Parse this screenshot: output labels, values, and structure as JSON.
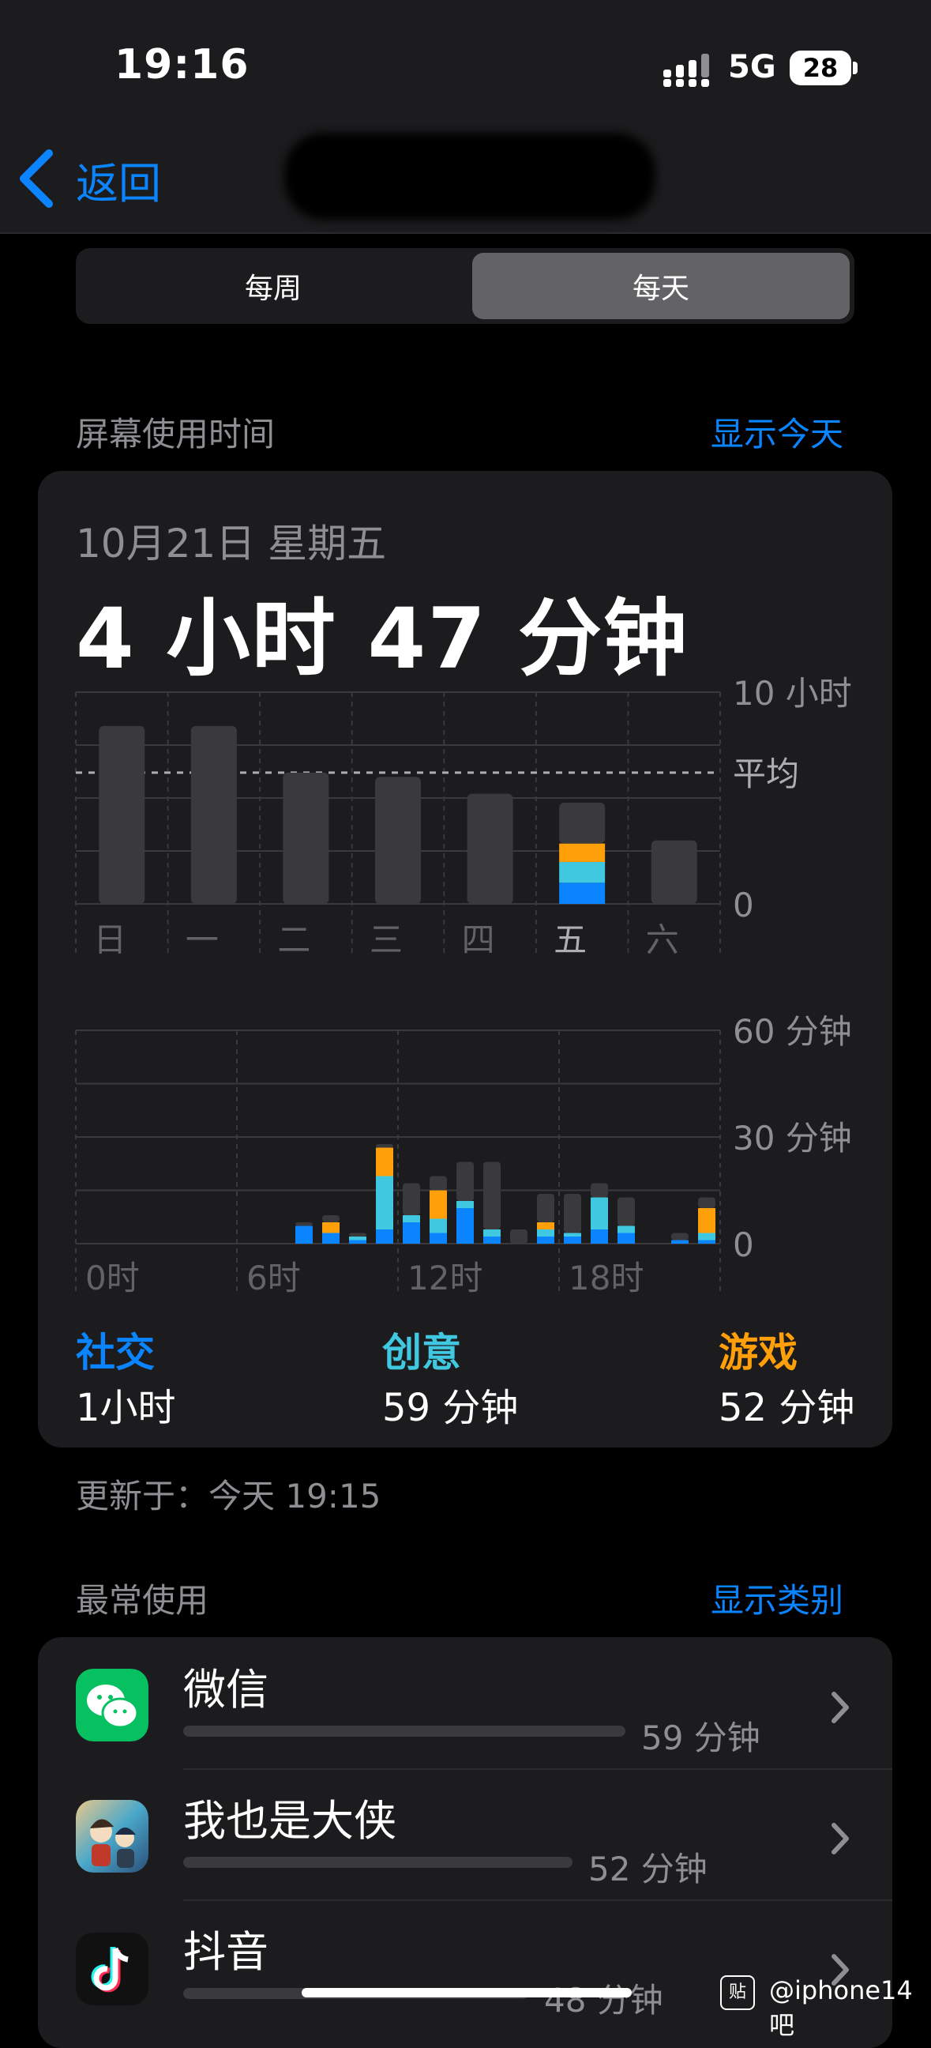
{
  "status_bar": {
    "time": "19:16",
    "network": "5G",
    "battery": "28"
  },
  "nav": {
    "back_label": "返回"
  },
  "segmented": {
    "options": [
      "每周",
      "每天"
    ],
    "selected": "每天"
  },
  "screen_time": {
    "section_title": "屏幕使用时间",
    "show_today": "显示今天",
    "date": "10月21日 星期五",
    "total": "4 小时 47 分钟",
    "categories": [
      {
        "name": "社交",
        "value": "1小时",
        "color": "#0a84ff"
      },
      {
        "name": "创意",
        "value": "59 分钟",
        "color": "#40c8e0"
      },
      {
        "name": "游戏",
        "value": "52 分钟",
        "color": "#ff9f0a"
      }
    ],
    "updated": "更新于：今天 19:15"
  },
  "chart_data": [
    {
      "type": "bar",
      "categories": [
        "日",
        "一",
        "二",
        "三",
        "四",
        "五",
        "六"
      ],
      "ylabels": [
        "10 小时",
        "平均",
        "0"
      ],
      "ylim": [
        0,
        10
      ],
      "average": 6.2,
      "values": [
        8.4,
        8.4,
        6.2,
        6.0,
        5.2,
        4.78,
        3.0
      ],
      "selected_category": "五",
      "selected_breakdown": {
        "social": 1.0,
        "creative": 0.98,
        "games": 0.87,
        "other": 1.93
      },
      "colors": {
        "other": "#3a3a3c",
        "social": "#0a84ff",
        "creative": "#40c8e0",
        "games": "#ff9f0a"
      }
    },
    {
      "type": "bar",
      "stacked": true,
      "x_ticks": [
        "0时",
        "6时",
        "12时",
        "18时"
      ],
      "ylabels": [
        "60 分钟",
        "30 分钟",
        "0"
      ],
      "ylim": [
        0,
        60
      ],
      "hours": [
        0,
        1,
        2,
        3,
        4,
        5,
        6,
        7,
        8,
        9,
        10,
        11,
        12,
        13,
        14,
        15,
        16,
        17,
        18,
        19,
        20,
        21,
        22,
        23
      ],
      "series": [
        {
          "name": "社交",
          "values": [
            0,
            0,
            0,
            0,
            0,
            0,
            0,
            0,
            5,
            3,
            1,
            4,
            6,
            3,
            10,
            2,
            0,
            2,
            2,
            4,
            3,
            0,
            1,
            1
          ]
        },
        {
          "name": "创意",
          "values": [
            0,
            0,
            0,
            0,
            0,
            0,
            0,
            0,
            0,
            0,
            1,
            15,
            2,
            4,
            2,
            2,
            0,
            2,
            1,
            9,
            2,
            0,
            0,
            2
          ]
        },
        {
          "name": "游戏",
          "values": [
            0,
            0,
            0,
            0,
            0,
            0,
            0,
            0,
            0,
            3,
            0,
            8,
            0,
            8,
            0,
            0,
            0,
            2,
            0,
            0,
            0,
            0,
            0,
            7
          ]
        },
        {
          "name": "其他",
          "values": [
            0,
            0,
            0,
            0,
            0,
            0,
            0,
            0,
            1,
            2,
            1,
            1,
            9,
            4,
            11,
            19,
            4,
            8,
            11,
            4,
            8,
            0,
            2,
            3
          ]
        }
      ]
    }
  ],
  "most_used": {
    "section_title": "最常使用",
    "show_categories": "显示类别",
    "apps": [
      {
        "name": "微信",
        "time": "59 分钟",
        "icon": "wechat-icon",
        "fraction": 1.0
      },
      {
        "name": "我也是大侠",
        "time": "52 分钟",
        "icon": "game-app-icon",
        "fraction": 0.88
      },
      {
        "name": "抖音",
        "time": "48 分钟",
        "icon": "douyin-icon",
        "fraction": 0.78
      }
    ]
  },
  "watermark": {
    "badge": "贴",
    "text": "@iphone14吧"
  }
}
